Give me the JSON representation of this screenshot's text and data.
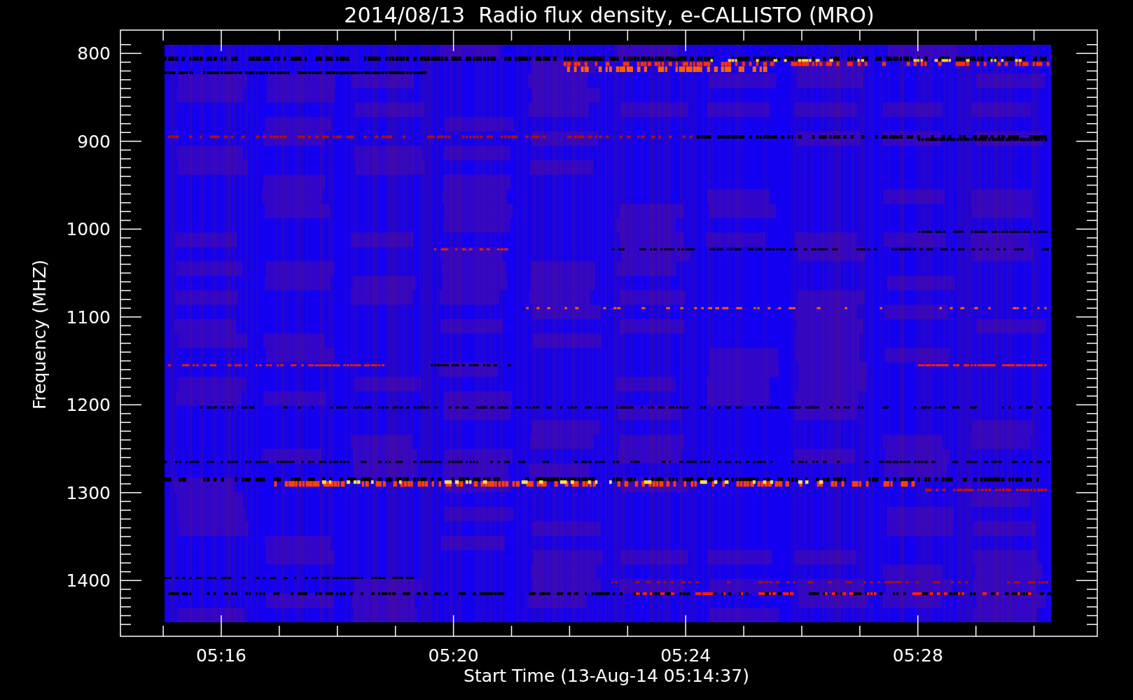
{
  "title": "2014/08/13  Radio flux density, e-CALLISTO (MRO)",
  "y_axis": {
    "label": "Frequency (MHZ)",
    "ticks": [
      "800",
      "900",
      "1000",
      "1100",
      "1200",
      "1300",
      "1400"
    ]
  },
  "x_axis": {
    "label": "Start Time (13-Aug-14 05:14:37)",
    "ticks": [
      "05:16",
      "05:20",
      "05:24",
      "05:28"
    ]
  }
}
